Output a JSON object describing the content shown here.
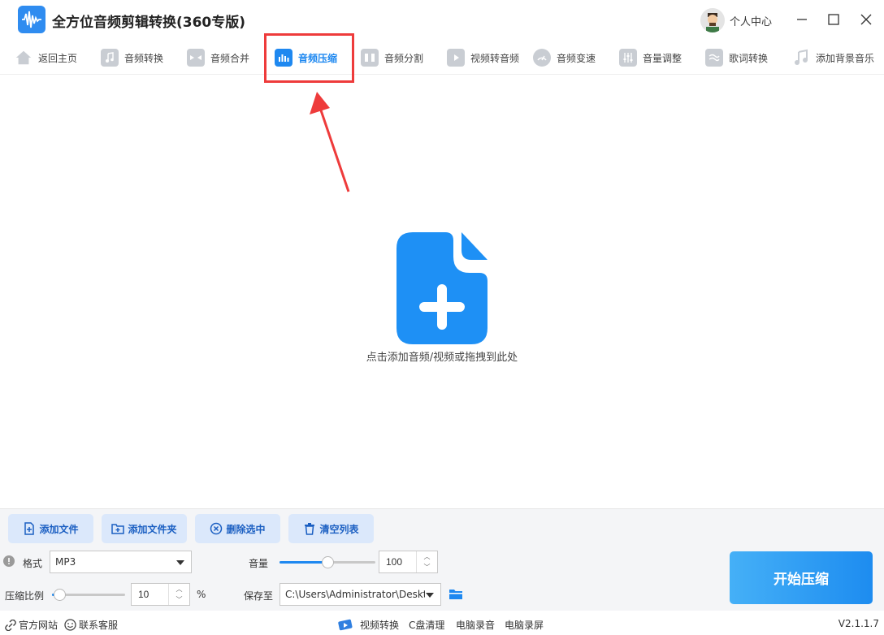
{
  "app": {
    "title": "全方位音频剪辑转换(360专版)",
    "user_label": "个人中心"
  },
  "toolbar": {
    "items": [
      {
        "label": "返回主页",
        "icon": "home-icon"
      },
      {
        "label": "音频转换",
        "icon": "music-note-icon"
      },
      {
        "label": "音频合并",
        "icon": "merge-icon"
      },
      {
        "label": "音频压缩",
        "icon": "audio-compress-icon",
        "active": true
      },
      {
        "label": "音频分割",
        "icon": "split-icon"
      },
      {
        "label": "视频转音频",
        "icon": "video-to-audio-icon"
      },
      {
        "label": "音频变速",
        "icon": "speed-gauge-icon"
      },
      {
        "label": "音量调整",
        "icon": "volume-sliders-icon"
      },
      {
        "label": "歌词转换",
        "icon": "lyrics-icon"
      },
      {
        "label": "添加背景音乐",
        "icon": "background-music-icon"
      }
    ]
  },
  "dropzone": {
    "hint": "点击添加音频/视频或拖拽到此处",
    "icon": "add-file-icon"
  },
  "actions": {
    "add_file": "添加文件",
    "add_folder": "添加文件夹",
    "delete_selected": "删除选中",
    "clear_list": "清空列表"
  },
  "settings": {
    "format_label": "格式",
    "format_value": "MP3",
    "volume_label": "音量",
    "volume_value": "100",
    "volume_level": 0.5,
    "ratio_label": "压缩比例",
    "ratio_value": "10",
    "ratio_unit": "%",
    "ratio_level": 0.1,
    "save_label": "保存至",
    "save_path": "C:\\Users\\Administrator\\Deskt",
    "start_button": "开始压缩"
  },
  "statusbar": {
    "official_site": "官方网站",
    "contact": "联系客服",
    "video_convert": "视频转换",
    "c_clean": "C盘清理",
    "pc_record_audio": "电脑录音",
    "pc_record_screen": "电脑录屏",
    "version": "V2.1.1.7"
  },
  "colors": {
    "accent": "#1e88f0",
    "highlight": "#ee3b3b",
    "button_bg": "#dbe8fb"
  }
}
